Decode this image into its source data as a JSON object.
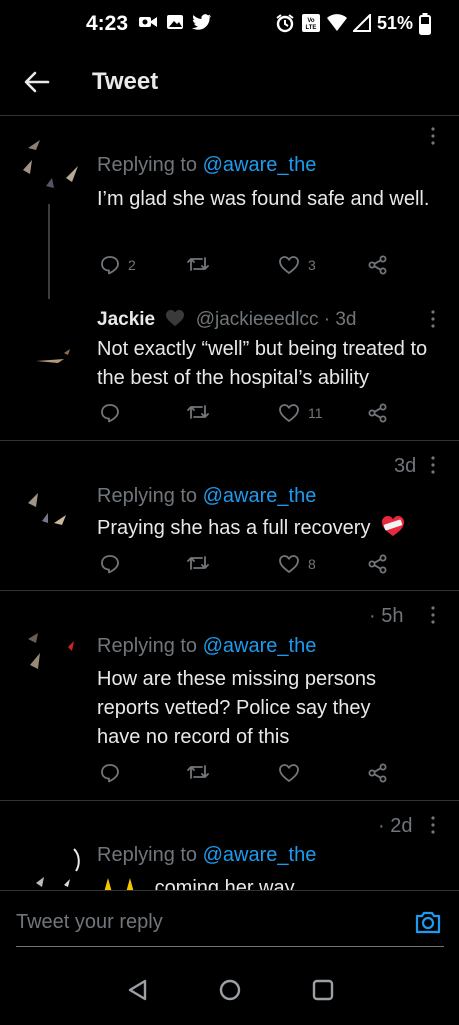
{
  "status_bar": {
    "time": "4:23",
    "battery": "51%"
  },
  "header": {
    "title": "Tweet"
  },
  "tweets": [
    {
      "replying_prefix": "Replying to",
      "replying_to": "@aware_the",
      "text": "I’m glad she was found safe and well.",
      "reply_count": "2",
      "retweet_count": "",
      "like_count": "3"
    },
    {
      "name": "Jackie",
      "handle": "@jackieeedlcc · 3d",
      "text": "Not exactly “well” but being treated to the best of the hospital’s ability",
      "reply_count": "",
      "retweet_count": "",
      "like_count": "11"
    },
    {
      "time": "3d",
      "replying_prefix": "Replying to",
      "replying_to": "@aware_the",
      "text": "Praying she has a full recovery",
      "reply_count": "",
      "retweet_count": "",
      "like_count": "8"
    },
    {
      "time": "· 5h",
      "replying_prefix": "Replying to",
      "replying_to": "@aware_the",
      "text": "How are these missing persons reports vetted? Police say they have no record of this",
      "reply_count": "",
      "retweet_count": "",
      "like_count": ""
    },
    {
      "time": "· 2d",
      "replying_prefix": "Replying to",
      "replying_to": "@aware_the",
      "text": "coming her way"
    }
  ],
  "reply_bar": {
    "placeholder": "Tweet your reply"
  },
  "colors": {
    "accent": "#1d9bf0",
    "muted": "#71767b",
    "text": "#e7e9ea",
    "background": "#000000"
  }
}
